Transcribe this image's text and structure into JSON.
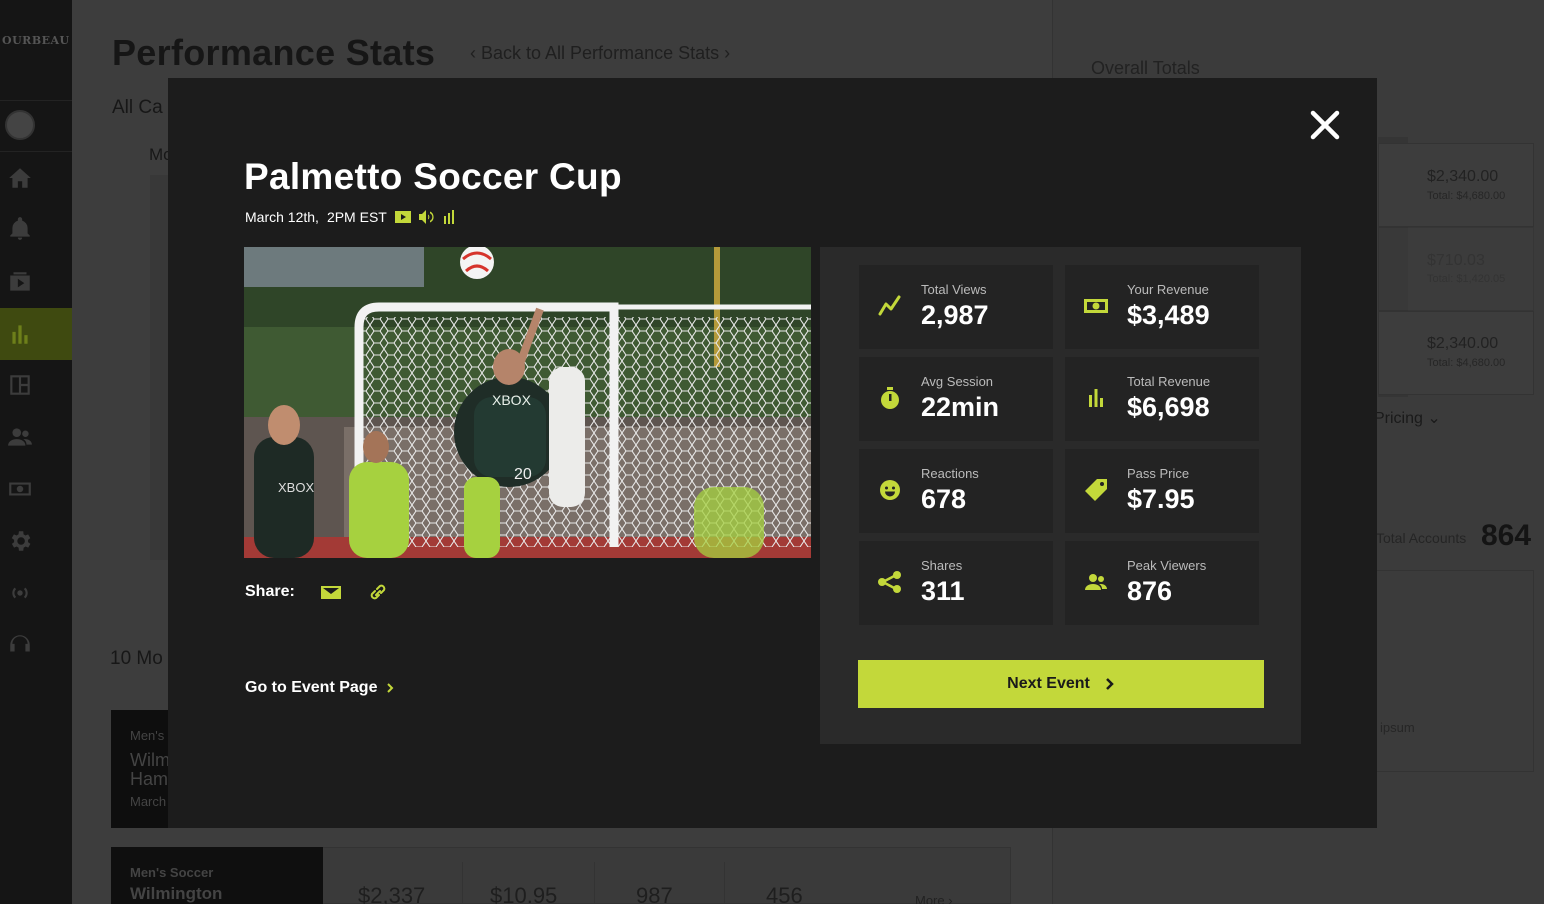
{
  "app": {
    "logo_text": "OURBEAU",
    "page_title": "Performance Stats",
    "back_link": "Back to All Performance Stats",
    "category_label": "All Ca",
    "sub_label": "Mo",
    "section_label": "10 Mo",
    "card": {
      "line1": "Men's",
      "line2": "Wilm",
      "line3": "Ham",
      "line4": "March"
    },
    "row": {
      "category": "Men's Soccer",
      "title": "Wilmington",
      "values": [
        "$2,337",
        "$10.95",
        "987",
        "456"
      ],
      "more": "More"
    },
    "right": {
      "overall_title": "Overall Totals",
      "price_cards": [
        {
          "amount": "$2,340.00",
          "total": "Total: $4,680.00"
        },
        {
          "amount": "$710.03",
          "total": "Total: $1,420.05"
        },
        {
          "amount": "$2,340.00",
          "total": "Total: $4,680.00"
        }
      ],
      "pricing_label": "Pricing",
      "total_accounts_label": "Total Accounts",
      "total_accounts_value": "864",
      "ipsum_text": "ipsum"
    },
    "sidebar_icons": [
      "home-icon",
      "bell-icon",
      "video-icon",
      "bar-chart-icon",
      "layout-icon",
      "users-icon",
      "money-icon",
      "gear-icon",
      "broadcast-icon",
      "support-icon"
    ],
    "active_sidebar": "bar-chart-icon"
  },
  "modal": {
    "title": "Palmetto Soccer Cup",
    "date": "March 12th,",
    "time": "2PM EST",
    "meta_icons": [
      "video-icon",
      "audio-icon",
      "stats-icon"
    ],
    "share_label": "Share:",
    "share_icons": [
      "email-icon",
      "link-icon"
    ],
    "go_event_label": "Go to Event Page",
    "next_event_label": "Next Event",
    "stats": [
      {
        "icon": "trend-icon",
        "label": "Total Views",
        "value": "2,987"
      },
      {
        "icon": "cash-icon",
        "label": "Your Revenue",
        "value": "$3,489"
      },
      {
        "icon": "stopwatch-icon",
        "label": "Avg Session",
        "value": "22min"
      },
      {
        "icon": "bar-chart-icon",
        "label": "Total Revenue",
        "value": "$6,698"
      },
      {
        "icon": "smiley-icon",
        "label": "Reactions",
        "value": "678"
      },
      {
        "icon": "tag-icon",
        "label": "Pass Price",
        "value": "$7.95"
      },
      {
        "icon": "share-icon",
        "label": "Shares",
        "value": "311"
      },
      {
        "icon": "users-icon",
        "label": "Peak Viewers",
        "value": "876"
      }
    ]
  },
  "colors": {
    "accent": "#c3d83a",
    "modal_bg": "#1c1c1c",
    "stats_panel_bg": "#2a2a2a",
    "tile_bg": "#232323"
  }
}
